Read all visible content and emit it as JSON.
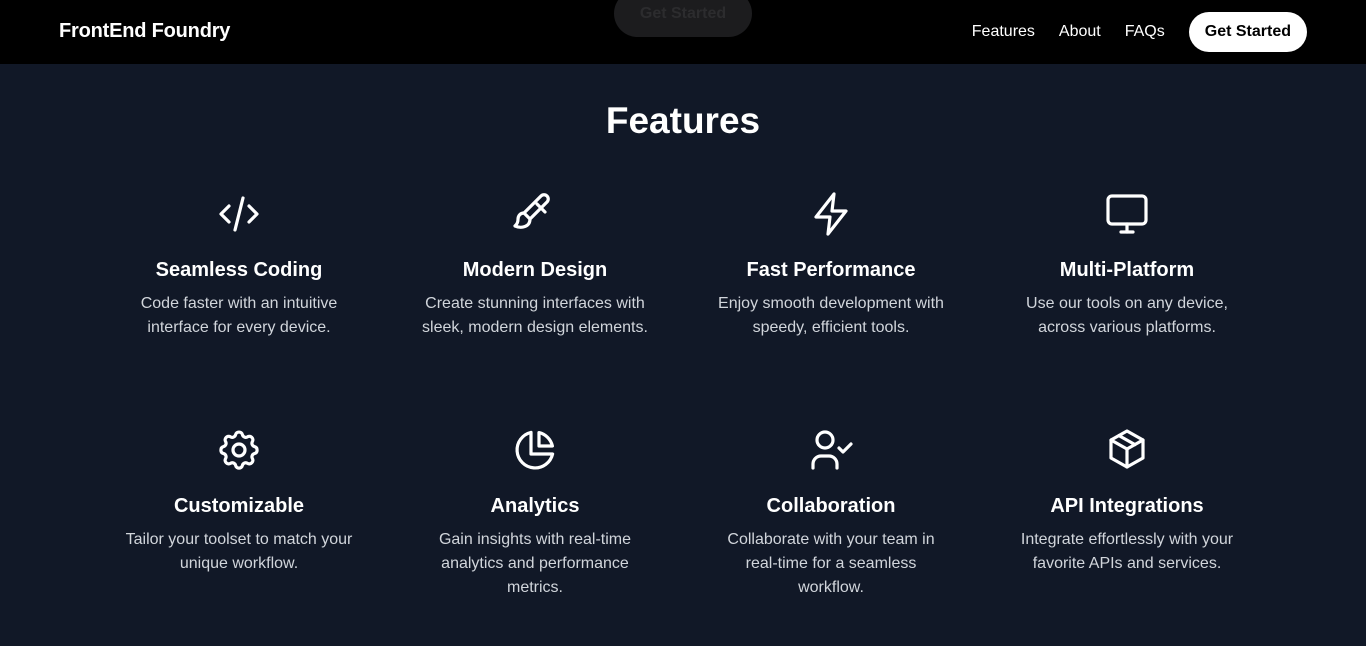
{
  "header": {
    "brand": "FrontEnd Foundry",
    "ghost_button": "Get Started",
    "nav": [
      "Features",
      "About",
      "FAQs"
    ],
    "cta": "Get Started"
  },
  "section": {
    "title": "Features",
    "features": [
      {
        "icon": "code-icon",
        "title": "Seamless Coding",
        "desc": "Code faster with an intuitive interface for every device."
      },
      {
        "icon": "paintbrush-icon",
        "title": "Modern Design",
        "desc": "Create stunning interfaces with sleek, modern design elements."
      },
      {
        "icon": "lightning-icon",
        "title": "Fast Performance",
        "desc": "Enjoy smooth development with speedy, efficient tools."
      },
      {
        "icon": "monitor-icon",
        "title": "Multi-Platform",
        "desc": "Use our tools on any device, across various platforms."
      },
      {
        "icon": "gear-icon",
        "title": "Customizable",
        "desc": "Tailor your toolset to match your unique workflow."
      },
      {
        "icon": "pie-chart-icon",
        "title": "Analytics",
        "desc": "Gain insights with real-time analytics and performance metrics."
      },
      {
        "icon": "user-check-icon",
        "title": "Collaboration",
        "desc": "Collaborate with your team in real-time for a seamless workflow."
      },
      {
        "icon": "cube-icon",
        "title": "API Integrations",
        "desc": "Integrate effortlessly with your favorite APIs and services."
      }
    ]
  },
  "colors": {
    "background": "#111827",
    "topbar": "#000000",
    "text": "#ffffff",
    "muted_text": "#d1d5db"
  }
}
